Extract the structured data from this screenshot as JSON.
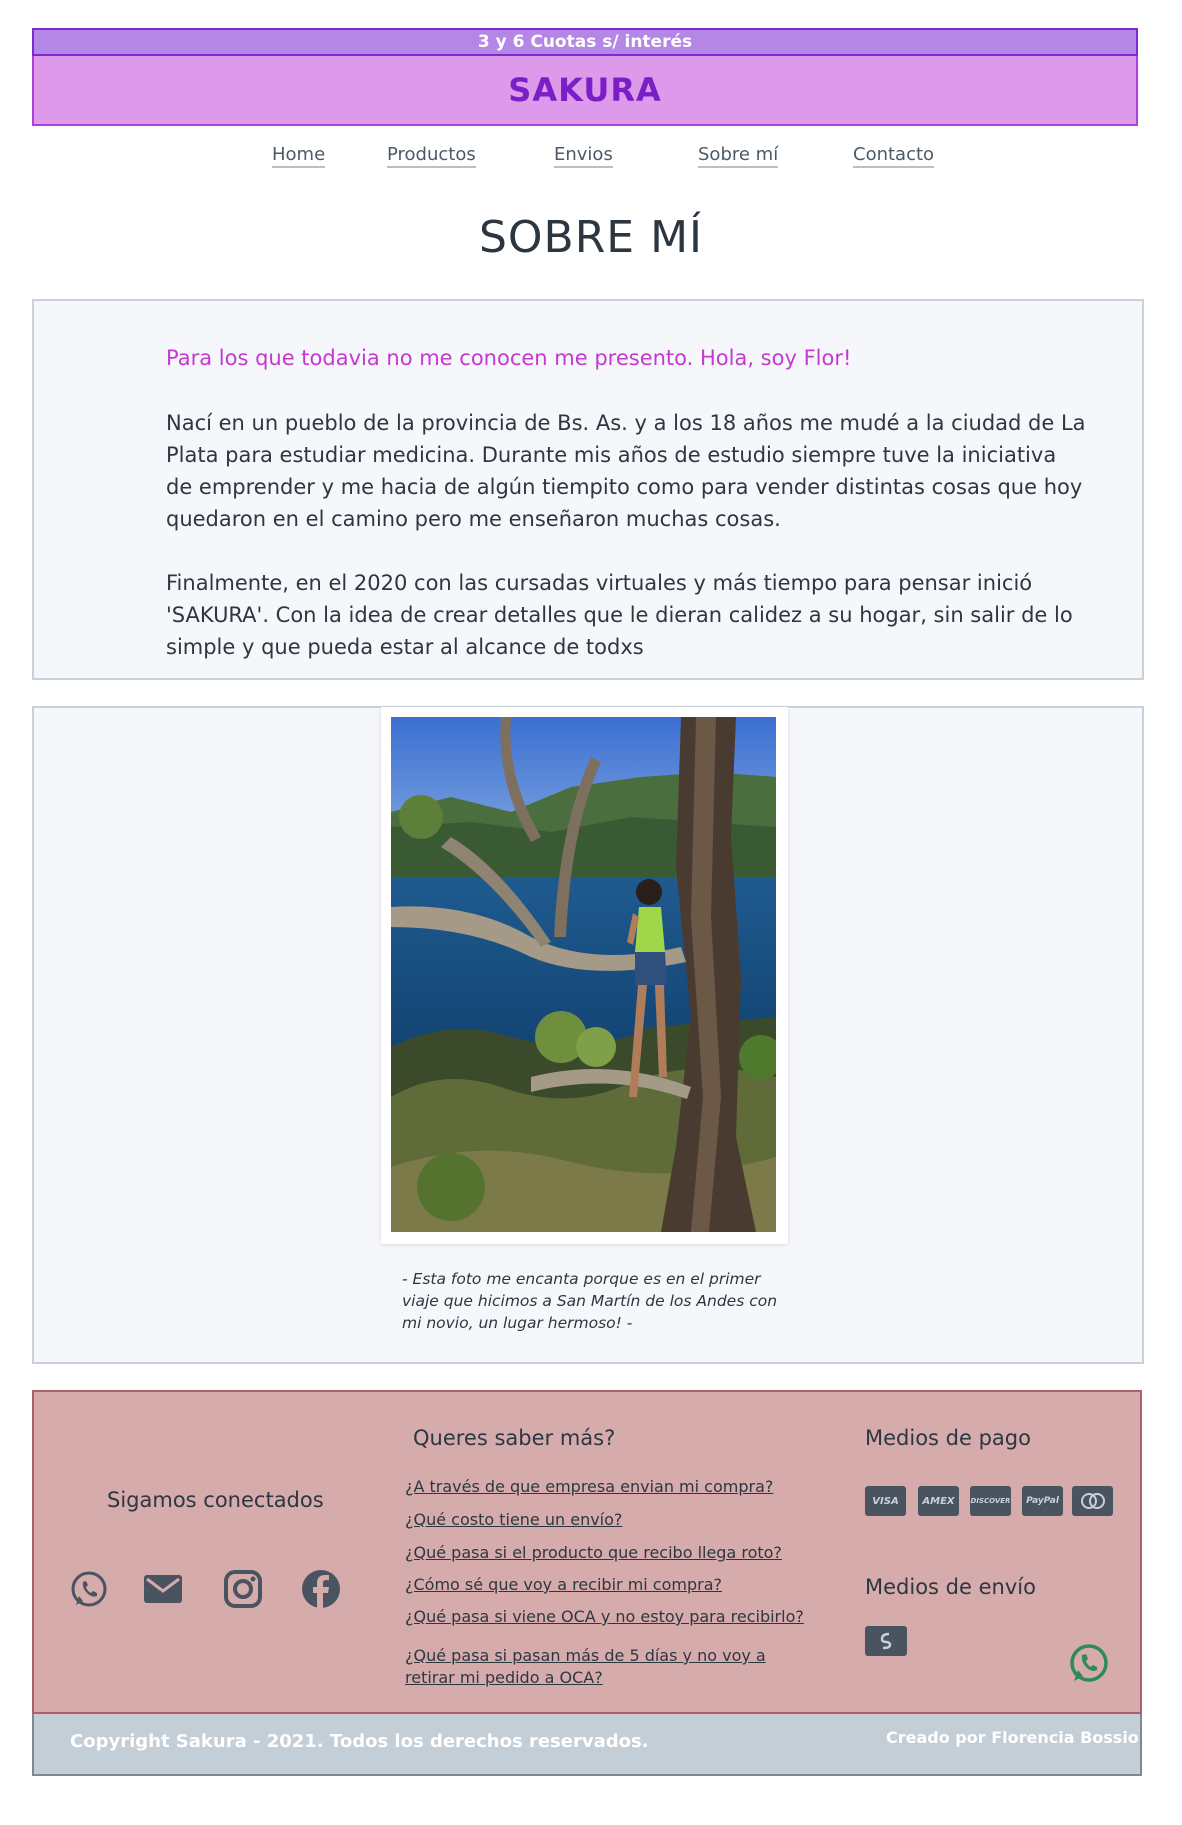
{
  "promo": {
    "text": "3 y 6 Cuotas s/ interés"
  },
  "brand": {
    "name": "SAKURA"
  },
  "nav": {
    "items": [
      {
        "label": "Home"
      },
      {
        "label": "Productos"
      },
      {
        "label": "Envios"
      },
      {
        "label": "Sobre mí"
      },
      {
        "label": "Contacto"
      }
    ]
  },
  "page": {
    "title": "SOBRE MÍ"
  },
  "about": {
    "intro": "Para los que todavia no me conocen me presento. Hola, soy Flor!",
    "paragraphs": [
      "Nací en un pueblo de la provincia de Bs. As. y a los 18 años me mudé a la ciudad de La Plata para estudiar medicina. Durante mis años de estudio siempre tuve la iniciativa de emprender y me hacia de algún tiempito como para vender distintas cosas que hoy quedaron en el camino pero me enseñaron muchas cosas.",
      "Finalmente, en el 2020 con las cursadas virtuales y más tiempo para pensar inició 'SAKURA'. Con la idea de crear detalles que le dieran calidez a su hogar, sin salir de lo simple y que pueda estar al alcance de todxs"
    ]
  },
  "photo": {
    "caption": "- Esta foto me encanta porque es en el primer viaje que hicimos a San Martín de los Andes con mi novio, un lugar hermoso! -"
  },
  "footer": {
    "social_heading": "Sigamos conectados",
    "social_icons": [
      "whatsapp-icon",
      "mail-icon",
      "instagram-icon",
      "facebook-icon"
    ],
    "faq_heading": "Queres saber más?",
    "faq": [
      "¿A través de que empresa envian mi compra?",
      "¿Qué costo tiene un envío?",
      "¿Qué pasa si el producto que recibo llega roto?",
      "¿Cómo sé que voy a recibir mi compra?",
      "¿Qué pasa si viene OCA y no estoy para recibirlo?",
      "¿Qué pasa si pasan más de 5 días y no voy a retirar mi pedido a OCA?"
    ],
    "payment_heading": "Medios de pago",
    "payment_methods": [
      "VISA",
      "AMEX",
      "DISCOVER",
      "PayPal",
      "mastercard"
    ],
    "shipping_heading": "Medios de envío",
    "copyright": "Copyright Sakura - 2021. Todos los derechos reservados.",
    "credits": "Creado por Florencia Bossio"
  },
  "colors": {
    "promo_bg": "#b486e6",
    "brand_bg": "#dd9aea",
    "brand_text": "#7a1fc8",
    "intro_text": "#c43ad1",
    "footer_bg": "#d6abab",
    "copyright_bg": "#c4ced6",
    "whatsapp_green": "#2e8b57"
  }
}
